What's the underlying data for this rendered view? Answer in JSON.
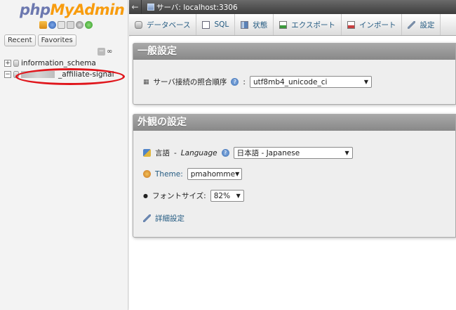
{
  "logo": {
    "part1": "php",
    "part2": "MyAdmin"
  },
  "nav_icons": [
    "home-icon",
    "exit-icon",
    "help-icon",
    "docs-icon",
    "settings-icon",
    "reload-icon"
  ],
  "nav_tabs": [
    "Recent",
    "Favorites"
  ],
  "tree": [
    {
      "name": "information_schema",
      "expander": "+"
    },
    {
      "name": "_affiliate-signal",
      "expander": "−"
    }
  ],
  "topbar": {
    "back": "←",
    "server_label": "サーバ: localhost:3306"
  },
  "menu_tabs": [
    {
      "label": "データベース",
      "icon": "database-icon"
    },
    {
      "label": "SQL",
      "icon": "sql-icon"
    },
    {
      "label": "状態",
      "icon": "status-icon"
    },
    {
      "label": "エクスポート",
      "icon": "export-icon"
    },
    {
      "label": "インポート",
      "icon": "import-icon"
    },
    {
      "label": "設定",
      "icon": "settings-icon"
    }
  ],
  "general": {
    "title": "一般設定",
    "collation_label": "サーバ接続の照合順序",
    "collation_value": "utf8mb4_unicode_ci"
  },
  "appearance": {
    "title": "外観の設定",
    "language_label": "言語",
    "language_label_en": "Language",
    "language_value": "日本語 - Japanese",
    "theme_label": "Theme:",
    "theme_value": "pmahomme",
    "fontsize_label": "フォントサイズ:",
    "fontsize_value": "82%",
    "more_settings": "詳細設定"
  }
}
